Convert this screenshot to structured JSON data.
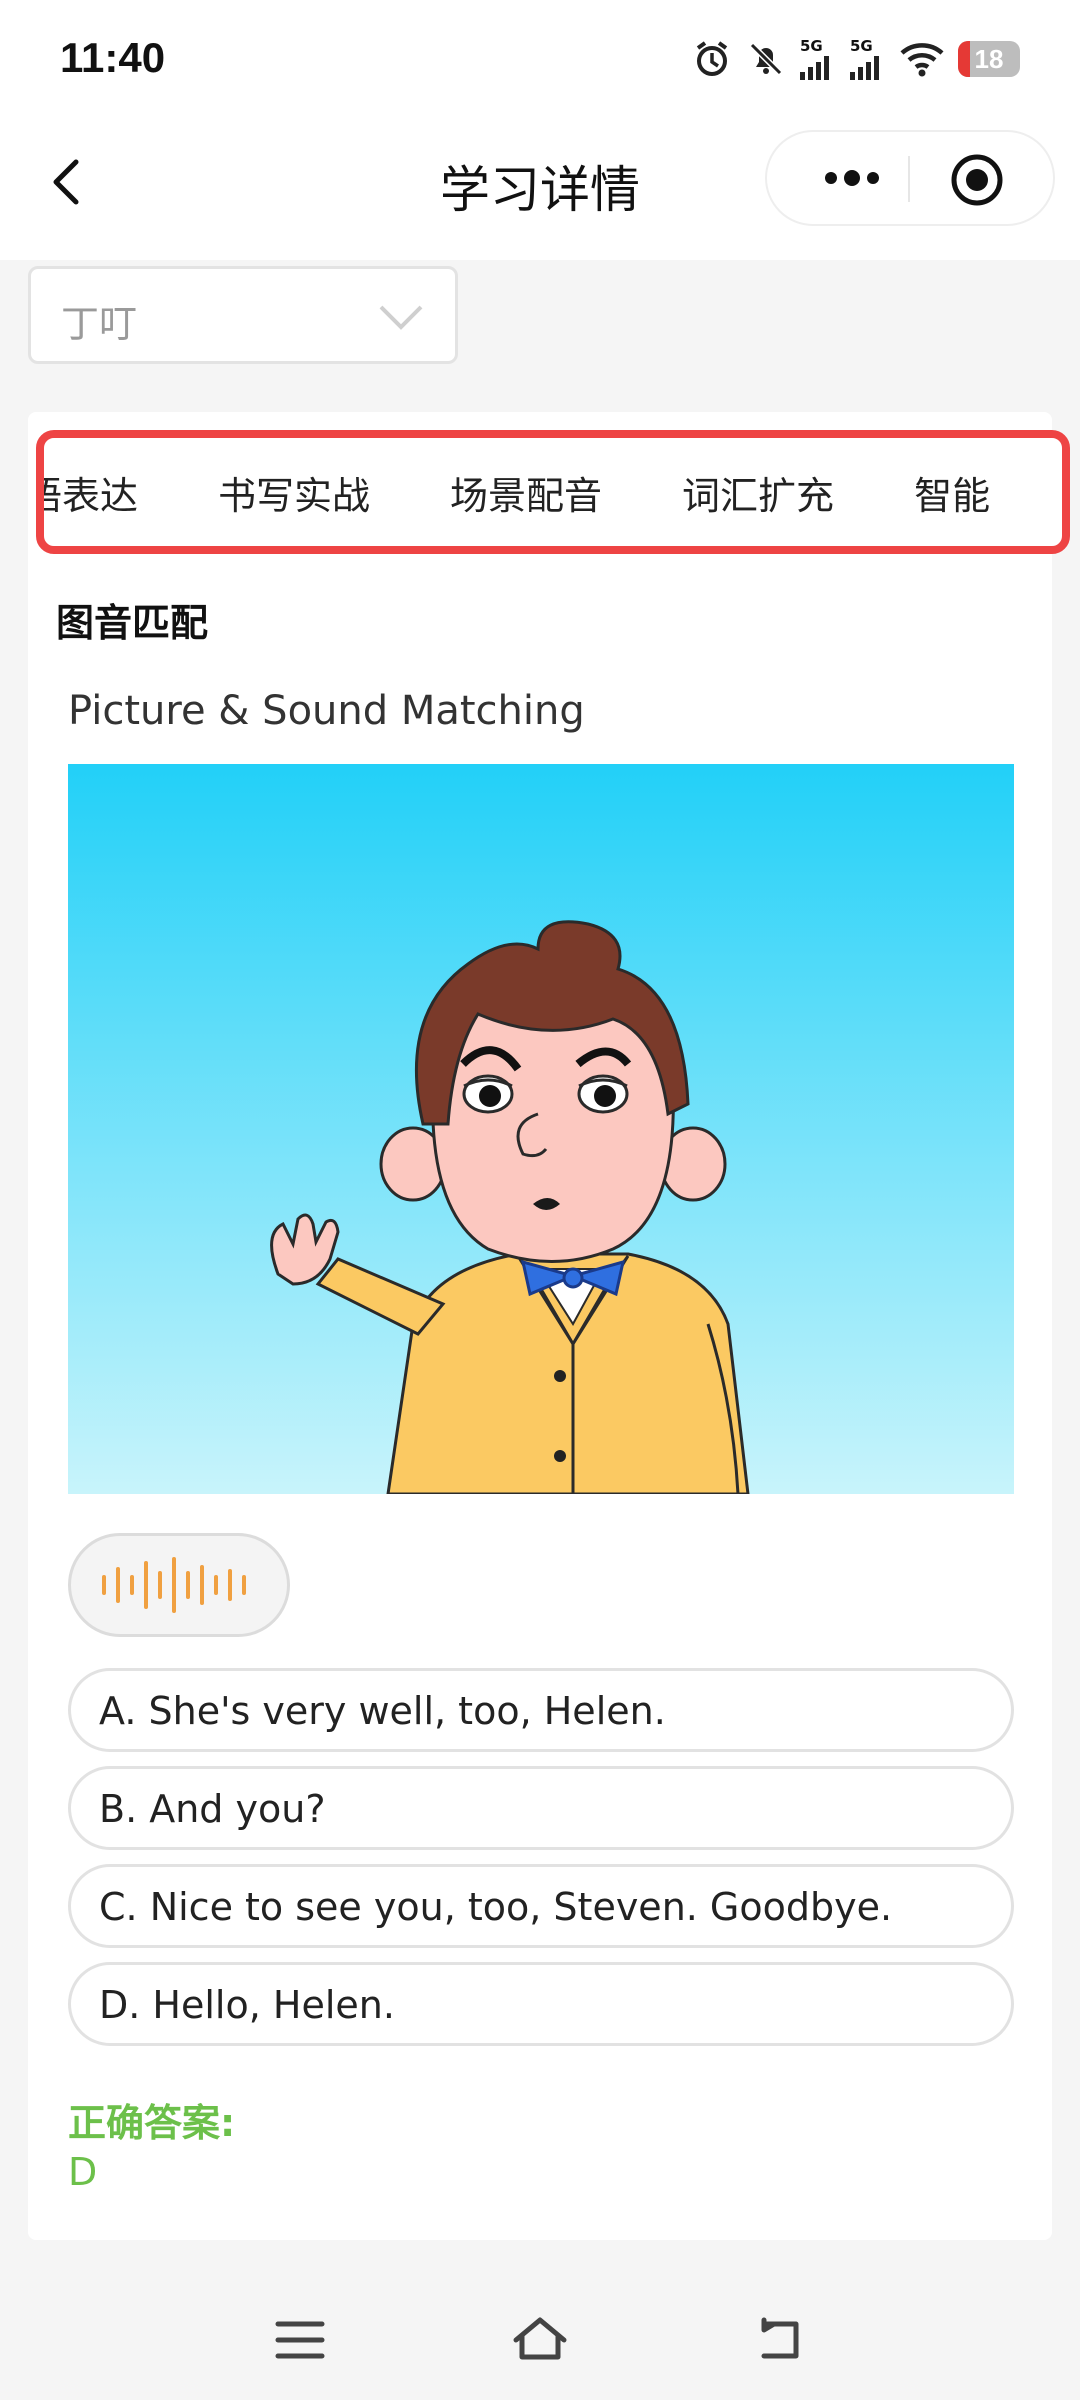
{
  "status_bar": {
    "time": "11:40",
    "battery": "18",
    "signal_labels": [
      "5G",
      "5G"
    ]
  },
  "nav": {
    "title": "学习详情"
  },
  "student_select": {
    "value": "丁叮"
  },
  "tabs": [
    "语表达",
    "书写实战",
    "场景配音",
    "词汇扩充",
    "智能"
  ],
  "section": {
    "title": "图音匹配",
    "subtitle": "Picture & Sound Matching"
  },
  "options": [
    "A. She's very well, too, Helen.",
    "B. And you?",
    "C. Nice to see you, too, Steven. Goodbye.",
    "D. Hello, Helen."
  ],
  "answer": {
    "label": "正确答案:",
    "value": "D"
  },
  "colors": {
    "highlight_border": "#ee4444",
    "answer_green": "#6cc04a",
    "audio_wave": "#f0a040",
    "sky_top": "#22d0f8",
    "sky_bottom": "#c8f4fb"
  }
}
